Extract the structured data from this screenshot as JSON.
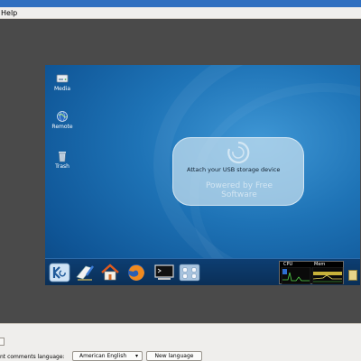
{
  "menu": {
    "help_label": "Help"
  },
  "desktop": {
    "icons": [
      {
        "label": "Media",
        "icon": "drive-icon"
      },
      {
        "label": "Remote",
        "icon": "globe-icon"
      },
      {
        "label": "Trash",
        "icon": "trash-icon"
      }
    ],
    "notification": {
      "message": "Attach your USB storage device",
      "watermark": "Powered by Free Software"
    },
    "panel": {
      "launchers": [
        "kde-menu-icon",
        "text-editor-icon",
        "home-folder-icon",
        "firefox-icon",
        "terminal-icon",
        "network-icon"
      ],
      "monitor": {
        "cpu_label": "CPU",
        "mem_label": "Mem"
      }
    }
  },
  "bottom": {
    "language_label": "nt comments language:",
    "language_value": "American English",
    "new_language_label": "New language"
  },
  "colors": {
    "titlebar": "#2f6fc0",
    "desktop_bg": "#1e73b6",
    "panel_bg": "#0d3e72"
  }
}
